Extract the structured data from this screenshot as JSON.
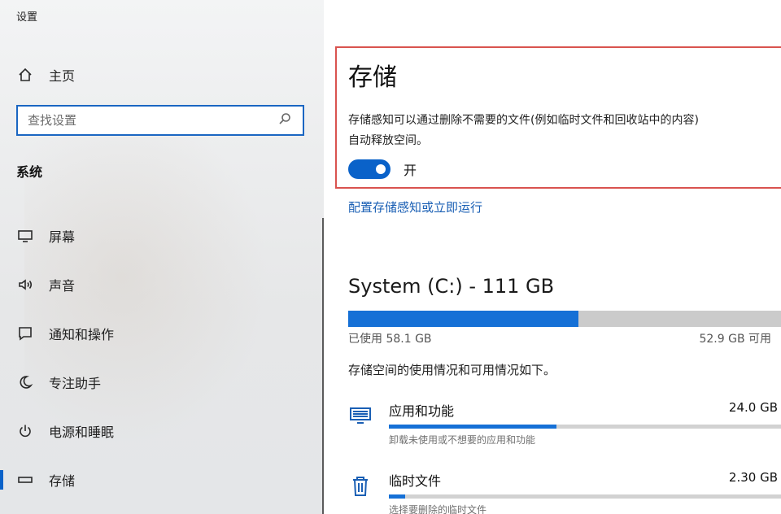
{
  "app": {
    "title": "设置"
  },
  "sidebar": {
    "home_label": "主页",
    "search_placeholder": "查找设置",
    "section_heading": "系统",
    "items": [
      {
        "label": "屏幕",
        "icon": "monitor-icon"
      },
      {
        "label": "声音",
        "icon": "speaker-icon"
      },
      {
        "label": "通知和操作",
        "icon": "notification-icon"
      },
      {
        "label": "专注助手",
        "icon": "moon-icon"
      },
      {
        "label": "电源和睡眠",
        "icon": "power-icon"
      },
      {
        "label": "存储",
        "icon": "storage-icon",
        "active": true
      }
    ]
  },
  "main": {
    "title": "存储",
    "description_line1": "存储感知可以通过删除不需要的文件(例如临时文件和回收站中的内容)",
    "description_line2": "自动释放空间。",
    "toggle_label": "开",
    "toggle_on": true,
    "config_link": "配置存储感知或立即运行",
    "drive": {
      "title": "System (C:) - 111 GB",
      "used_label": "已使用 58.1 GB",
      "free_label": "52.9 GB 可用",
      "used_gb": 58.1,
      "total_gb": 111
    },
    "usage_description": "存储空间的使用情况和可用情况如下。",
    "categories": [
      {
        "name": "应用和功能",
        "size": "24.0 GB",
        "subtitle": "卸载未使用或不想要的应用和功能",
        "fraction": 0.42,
        "icon": "apps-icon"
      },
      {
        "name": "临时文件",
        "size": "2.30 GB",
        "subtitle": "选择要删除的临时文件",
        "fraction": 0.04,
        "icon": "trash-icon"
      }
    ]
  },
  "colors": {
    "accent": "#0a62c9",
    "highlight_border": "#d9534f",
    "link": "#1a5fb4"
  }
}
